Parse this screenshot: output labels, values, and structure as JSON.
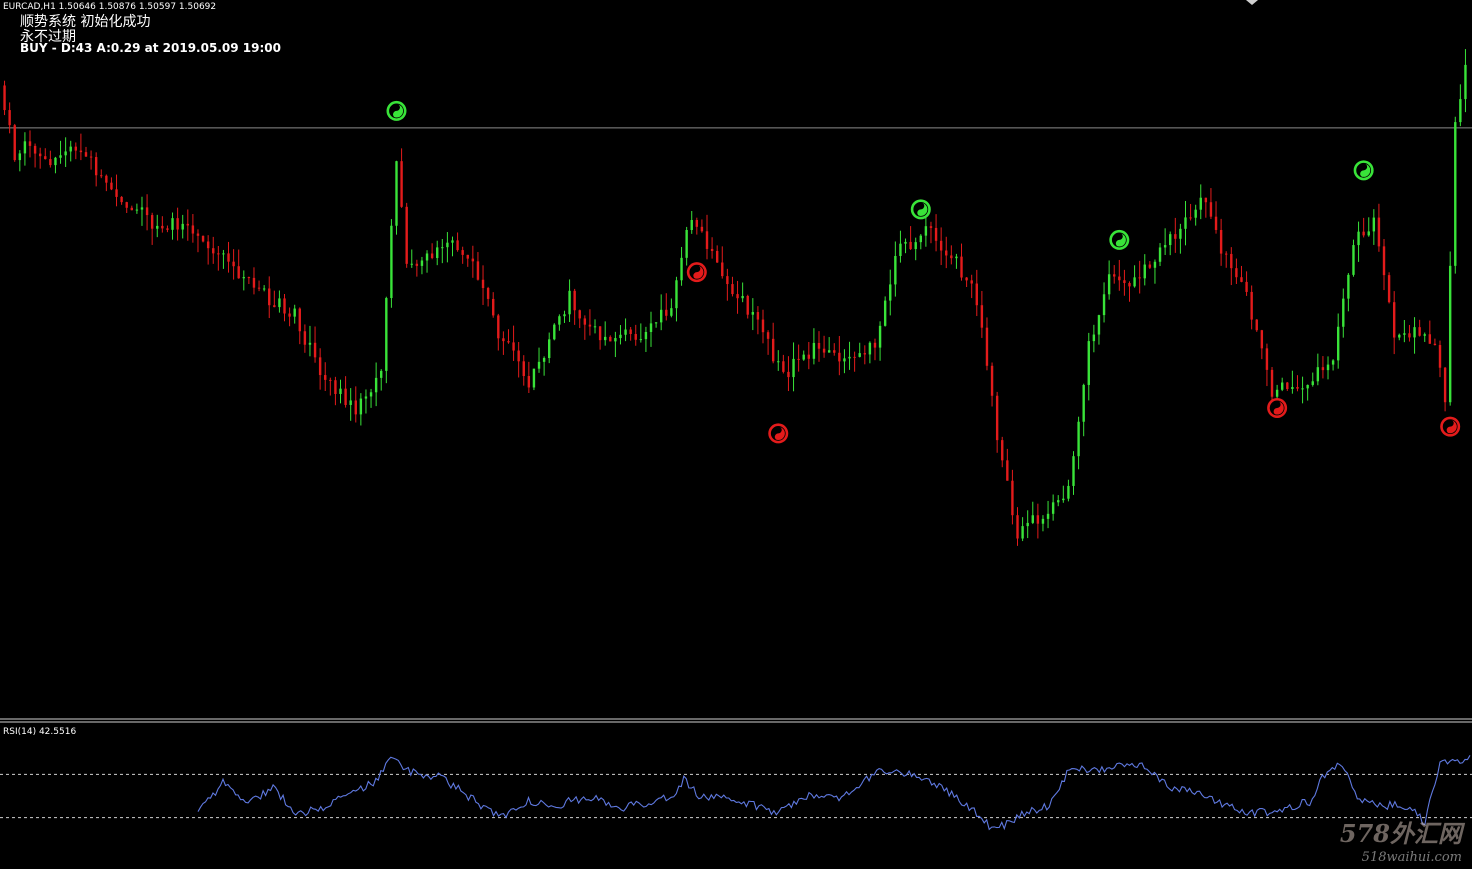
{
  "header": {
    "symbol_line": "EURCAD,H1  1.50646 1.50876 1.50597 1.50692",
    "line1": "顺势系统 初始化成功",
    "line2": "永不过期",
    "line3": "BUY - D:43 A:0.29  at 2019.05.09 19:00"
  },
  "rsi": {
    "label": "RSI(14) 42.5516",
    "line_color": "#5f79e0"
  },
  "watermark": {
    "main": "578外汇网",
    "url": "518waihui.com"
  },
  "colors": {
    "bull": "#39e339",
    "bear": "#e31b1b",
    "background": "#000000"
  },
  "chart_data": [
    {
      "type": "candlestick",
      "series_colors": {
        "up": "#39e339",
        "down": "#e31b1b"
      },
      "horizontal_level": 1.514,
      "ylim": [
        1.48,
        1.518
      ],
      "candle_count": 288,
      "path": [
        [
          0,
          1.5165
        ],
        [
          3,
          1.5125
        ],
        [
          6,
          1.5132
        ],
        [
          10,
          1.5118
        ],
        [
          16,
          1.5128
        ],
        [
          22,
          1.5102
        ],
        [
          30,
          1.5085
        ],
        [
          38,
          1.508
        ],
        [
          48,
          1.505
        ],
        [
          58,
          1.503
        ],
        [
          64,
          1.499
        ],
        [
          70,
          1.4975
        ],
        [
          75,
          1.4995
        ],
        [
          78,
          1.512
        ],
        [
          80,
          1.506
        ],
        [
          84,
          1.5065
        ],
        [
          88,
          1.5075
        ],
        [
          94,
          1.5055
        ],
        [
          98,
          1.502
        ],
        [
          104,
          1.499
        ],
        [
          112,
          1.504
        ],
        [
          118,
          1.5015
        ],
        [
          126,
          1.502
        ],
        [
          132,
          1.5035
        ],
        [
          136,
          1.509
        ],
        [
          139,
          1.507
        ],
        [
          142,
          1.505
        ],
        [
          148,
          1.503
        ],
        [
          154,
          1.4995
        ],
        [
          160,
          1.501
        ],
        [
          166,
          1.5
        ],
        [
          172,
          1.5012
        ],
        [
          176,
          1.5065
        ],
        [
          182,
          1.508
        ],
        [
          188,
          1.506
        ],
        [
          192,
          1.504
        ],
        [
          196,
          1.496
        ],
        [
          200,
          1.49
        ],
        [
          204,
          1.491
        ],
        [
          210,
          1.4925
        ],
        [
          214,
          1.501
        ],
        [
          218,
          1.5055
        ],
        [
          222,
          1.5045
        ],
        [
          226,
          1.506
        ],
        [
          232,
          1.508
        ],
        [
          236,
          1.51
        ],
        [
          240,
          1.507
        ],
        [
          244,
          1.505
        ],
        [
          250,
          1.4985
        ],
        [
          256,
          1.499
        ],
        [
          262,
          1.5005
        ],
        [
          266,
          1.5075
        ],
        [
          270,
          1.5085
        ],
        [
          274,
          1.502
        ],
        [
          278,
          1.502
        ],
        [
          282,
          1.501
        ],
        [
          284,
          1.498
        ],
        [
          286,
          1.514
        ],
        [
          288,
          1.5175
        ]
      ],
      "signals": [
        {
          "kind": "buy",
          "index": 77,
          "price": 1.515
        },
        {
          "kind": "sell",
          "index": 136,
          "price": 1.5055
        },
        {
          "kind": "sell",
          "index": 152,
          "price": 1.496
        },
        {
          "kind": "buy",
          "index": 180,
          "price": 1.5092
        },
        {
          "kind": "buy",
          "index": 219,
          "price": 1.5074
        },
        {
          "kind": "sell",
          "index": 250,
          "price": 1.4975
        },
        {
          "kind": "buy",
          "index": 267,
          "price": 1.5115
        },
        {
          "kind": "sell",
          "index": 284,
          "price": 1.4964
        }
      ]
    },
    {
      "type": "line",
      "series": [
        {
          "name": "RSI(14)",
          "values": [
            42.5516
          ]
        }
      ],
      "levels": [
        70,
        30
      ],
      "ylim": [
        0,
        100
      ],
      "path": [
        [
          40,
          35
        ],
        [
          45,
          62
        ],
        [
          50,
          44
        ],
        [
          55,
          58
        ],
        [
          60,
          33
        ],
        [
          66,
          42
        ],
        [
          72,
          55
        ],
        [
          76,
          65
        ],
        [
          78,
          86
        ],
        [
          82,
          73
        ],
        [
          88,
          68
        ],
        [
          94,
          50
        ],
        [
          100,
          30
        ],
        [
          106,
          45
        ],
        [
          112,
          42
        ],
        [
          118,
          50
        ],
        [
          124,
          38
        ],
        [
          130,
          44
        ],
        [
          135,
          52
        ],
        [
          137,
          65
        ],
        [
          140,
          50
        ],
        [
          148,
          45
        ],
        [
          156,
          35
        ],
        [
          162,
          52
        ],
        [
          168,
          47
        ],
        [
          176,
          74
        ],
        [
          182,
          71
        ],
        [
          188,
          60
        ],
        [
          194,
          40
        ],
        [
          199,
          18
        ],
        [
          204,
          32
        ],
        [
          210,
          42
        ],
        [
          214,
          75
        ],
        [
          222,
          76
        ],
        [
          228,
          80
        ],
        [
          234,
          58
        ],
        [
          240,
          52
        ],
        [
          246,
          40
        ],
        [
          250,
          35
        ],
        [
          256,
          36
        ],
        [
          262,
          45
        ],
        [
          265,
          70
        ],
        [
          268,
          82
        ],
        [
          272,
          45
        ],
        [
          276,
          42
        ],
        [
          282,
          40
        ],
        [
          285,
          25
        ],
        [
          288,
          80
        ],
        [
          294,
          85
        ]
      ]
    }
  ]
}
